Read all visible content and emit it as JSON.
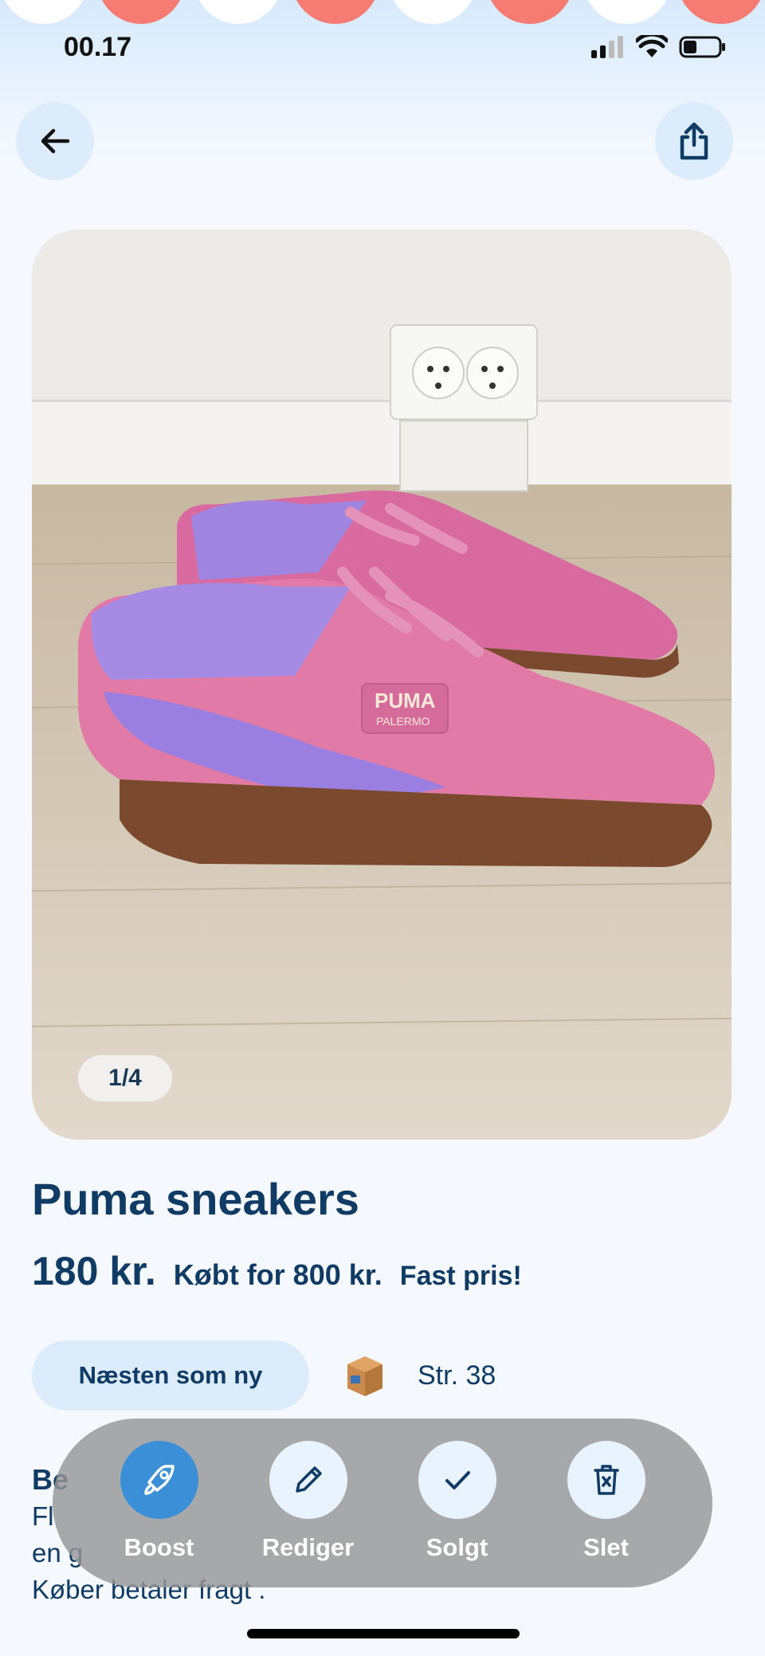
{
  "status_bar": {
    "time": "00.17"
  },
  "header": {
    "back_icon": "arrow-left-icon",
    "share_icon": "share-icon"
  },
  "gallery": {
    "page_indicator": "1/4"
  },
  "listing": {
    "title": "Puma sneakers",
    "price": "180 kr.",
    "original_price": "Købt for 800 kr.",
    "price_note": "Fast pris!",
    "condition": "Næsten som ny",
    "shipping_icon": "package-icon",
    "size": "Str. 38"
  },
  "description": {
    "title": "Be",
    "line1": "Fl",
    "line2": "en g",
    "line3": "Køber betaler fragt ."
  },
  "actions": {
    "boost": "Boost",
    "edit": "Rediger",
    "sold": "Solgt",
    "delete": "Slet"
  },
  "colors": {
    "primary_text": "#0f3b64",
    "accent_blue": "#3a8fd6",
    "chip_bg": "#dcecfb",
    "action_bar_bg": "#969696"
  }
}
